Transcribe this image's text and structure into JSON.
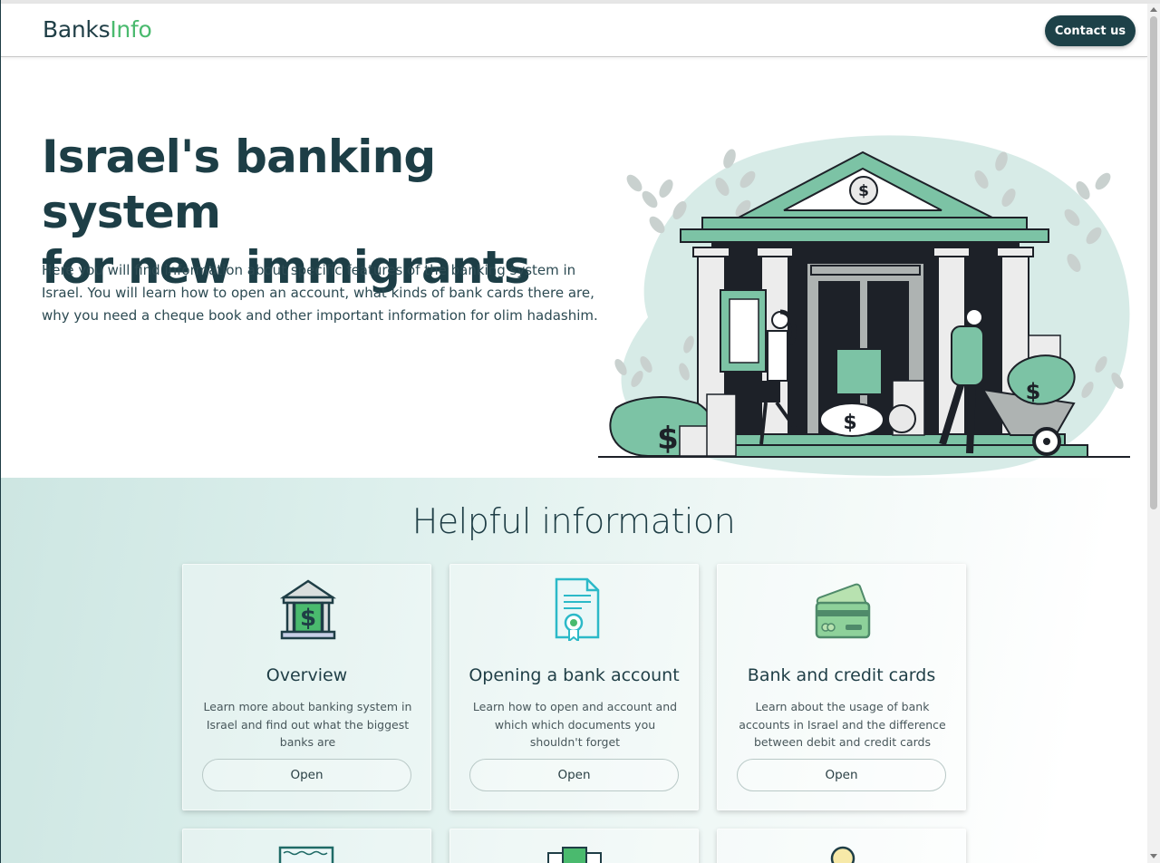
{
  "header": {
    "logo_part1": "Banks",
    "logo_part2": "Info",
    "contact_label": "Contact us"
  },
  "hero": {
    "title_line1": "Israel's banking system",
    "title_line2": "for new immigrants",
    "description": "Here you will find information about specific features of the banking system in Israel. You will learn how to open an account, what kinds of bank cards there are, why you need a cheque book and other important information for olim hadashim."
  },
  "helpful": {
    "title": "Helpful information",
    "cards": [
      {
        "title": "Overview",
        "description": "Learn more about banking system in Israel and find out what the biggest banks are",
        "button": "Open",
        "icon": "bank-dollar-icon"
      },
      {
        "title": "Opening a bank account",
        "description": "Learn how to open and account and which which documents you shouldn't forget",
        "button": "Open",
        "icon": "certificate-document-icon"
      },
      {
        "title": "Bank and credit cards",
        "description": "Learn about the usage of bank accounts in Israel and the difference between debit and credit cards",
        "button": "Open",
        "icon": "credit-cards-icon"
      }
    ]
  },
  "colors": {
    "brand_dark": "#1d3e46",
    "brand_green": "#4aba6e",
    "illustration_green": "#7cc3a5",
    "section_tint": "#cde6e2"
  }
}
